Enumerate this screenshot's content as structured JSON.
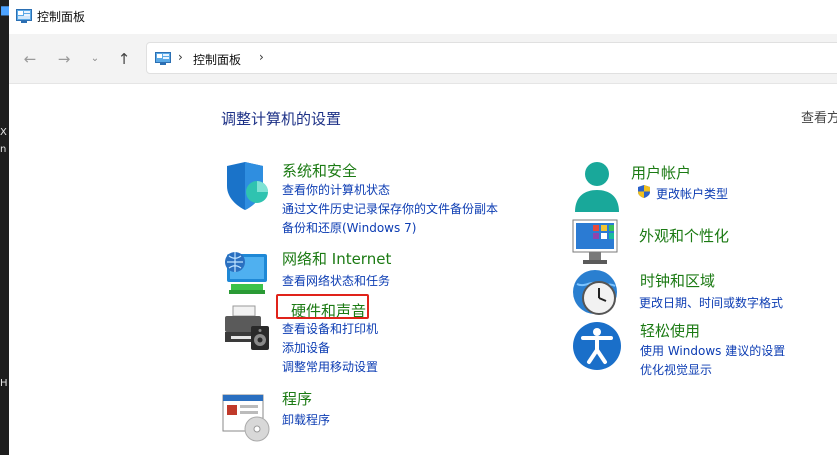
{
  "window": {
    "title": "控制面板"
  },
  "nav": {
    "breadcrumb": [
      "控制面板"
    ]
  },
  "main": {
    "heading": "调整计算机的设置",
    "view_by": "查看方",
    "categories": [
      {
        "title": "系统和安全",
        "links": [
          "查看你的计算机状态",
          "通过文件历史记录保存你的文件备份副本",
          "备份和还原(Windows 7)"
        ]
      },
      {
        "title": "网络和 Internet",
        "links": [
          "查看网络状态和任务"
        ]
      },
      {
        "title": "硬件和声音",
        "links": [
          "查看设备和打印机",
          "添加设备",
          "调整常用移动设置"
        ]
      },
      {
        "title": "程序",
        "links": [
          "卸载程序"
        ]
      },
      {
        "title": "用户帐户",
        "links": [
          "更改帐户类型"
        ]
      },
      {
        "title": "外观和个性化",
        "links": []
      },
      {
        "title": "时钟和区域",
        "links": [
          "更改日期、时间或数字格式"
        ]
      },
      {
        "title": "轻松使用",
        "links": [
          "使用 Windows 建议的设置",
          "优化视觉显示"
        ]
      }
    ]
  },
  "desktop_edge": {
    "chars": [
      "X",
      "n",
      "H"
    ]
  },
  "colors": {
    "category_title": "#1b7a13",
    "link": "#0d3db3",
    "heading": "#1e3287",
    "highlight": "#e0231a"
  }
}
